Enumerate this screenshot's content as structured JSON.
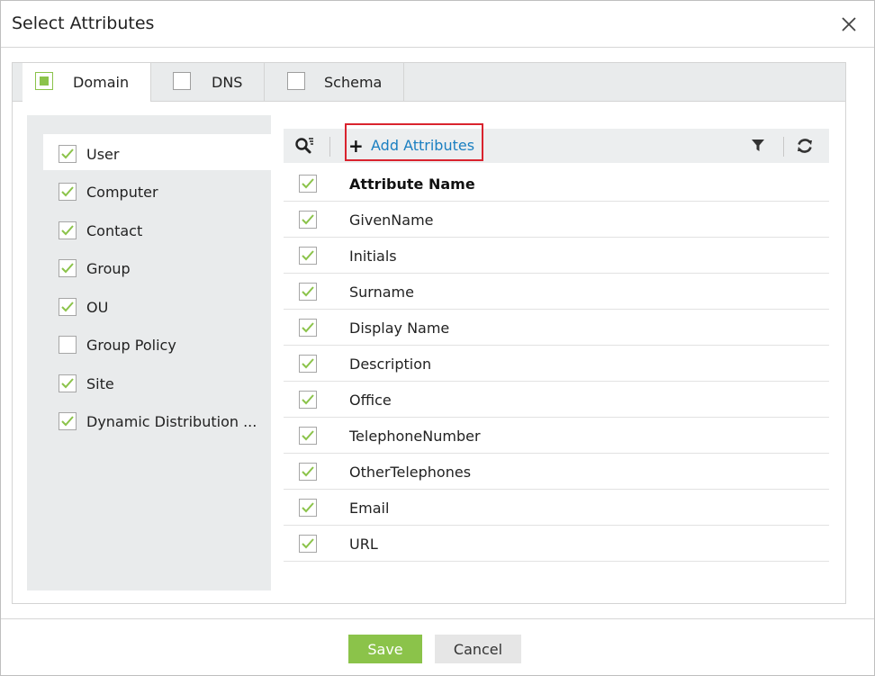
{
  "dialog": {
    "title": "Select Attributes"
  },
  "tabs": [
    {
      "label": "Domain",
      "active": true,
      "checked": "partial"
    },
    {
      "label": "DNS",
      "active": false,
      "checked": false
    },
    {
      "label": "Schema",
      "active": false,
      "checked": false
    }
  ],
  "sidebar": {
    "items": [
      {
        "label": "User",
        "checked": true,
        "selected": true
      },
      {
        "label": "Computer",
        "checked": true
      },
      {
        "label": "Contact",
        "checked": true
      },
      {
        "label": "Group",
        "checked": true
      },
      {
        "label": "OU",
        "checked": true
      },
      {
        "label": "Group Policy",
        "checked": false
      },
      {
        "label": "Site",
        "checked": true
      },
      {
        "label": "Dynamic Distribution ...",
        "checked": true
      }
    ]
  },
  "toolbar": {
    "add_label": "Add Attributes",
    "search_icon": "search-list-icon",
    "filter_icon": "filter-icon",
    "refresh_icon": "refresh-icon"
  },
  "table": {
    "header": "Attribute Name",
    "rows": [
      "GivenName",
      "Initials",
      "Surname",
      "Display Name",
      "Description",
      "Office",
      "TelephoneNumber",
      "OtherTelephones",
      "Email",
      "URL"
    ]
  },
  "footer": {
    "save_label": "Save",
    "cancel_label": "Cancel"
  },
  "colors": {
    "accent_green": "#8bc34a",
    "link_blue": "#1a7fc1",
    "highlight_red": "#d9232e",
    "panel_gray": "#e9ebec"
  }
}
